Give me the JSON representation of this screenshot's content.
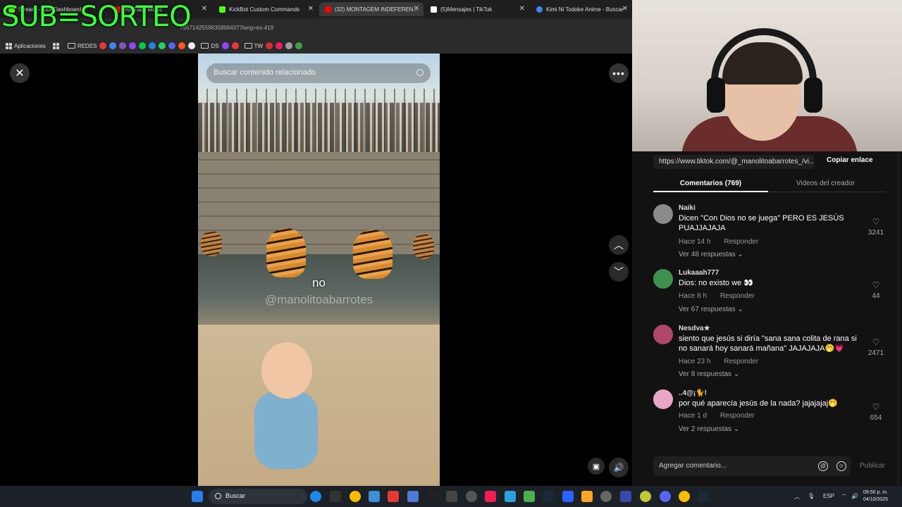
{
  "overlay": {
    "text": "SUB=SORTEO"
  },
  "browser": {
    "tabs": [
      {
        "label": "Stream - Kick Dashboard",
        "color": "#53fc18"
      },
      {
        "label": "YouTube Music",
        "color": "#ff0000"
      },
      {
        "label": "KickBot Custom Commands",
        "color": "#53fc18"
      },
      {
        "label": "(32) MONTAGEM INDEFEREN...",
        "color": "#ff0000"
      },
      {
        "label": "(5)Mensajes | TikTok",
        "color": "#ffffff"
      },
      {
        "label": "Kimi Ni Todoke Anime - Buscar",
        "color": "#4285f4"
      }
    ],
    "address": "7557142559835868437?lang=es-419",
    "bookmarks": {
      "apps": "Aplicaciones",
      "redes": "REDES",
      "ds": "DS",
      "tw": "TW"
    }
  },
  "video": {
    "search_placeholder": "Buscar contenido relacionado",
    "caption": "no",
    "watermark": "@manolitoabarrotes"
  },
  "panel": {
    "link": "https://www.tiktok.com/@_manolitoabarrotes_/vi...",
    "copy_label": "Copiar enlace",
    "tab_comments": "Comentarios (769)",
    "tab_videos": "Videos del creador",
    "reply_label": "Responder",
    "comments": [
      {
        "user": "Naiki",
        "text": "Dicen \"Con Dios no se juega\" PERO ES JESÚS PUAJJAJAJA",
        "time": "Hace 14 h",
        "more": "Ver 48 respuestas",
        "likes": "3241",
        "avatar_color": "#8a8a8a"
      },
      {
        "user": "Lukaaah777",
        "text": "Dios: no existo we 👀",
        "time": "Hace 8 h",
        "more": "Ver 67 respuestas",
        "likes": "44",
        "avatar_color": "#3f8f4f"
      },
      {
        "user": "Nesdva★",
        "text": "siento que jesús si diría \"sana sana colita de rana si no sanará hoy sanará mañana\" JAJAJAJA🤭💗",
        "time": "Hace 23 h",
        "more": "Ver 8 respuestas",
        "likes": "2471",
        "avatar_color": "#b0476a"
      },
      {
        "user": "..4@¡🐈!",
        "text": "por qué aparecía jesús de la nada? jajajajaj🤭",
        "time": "Hace 1 d",
        "more": "Ver 2 respuestas",
        "likes": "654",
        "avatar_color": "#e8a7c8"
      }
    ],
    "input_placeholder": "Agregar comentario...",
    "publish_label": "Publicar"
  },
  "taskbar": {
    "search_label": "Buscar",
    "lang": "ESP",
    "time": "09:50 p. m.",
    "date": "04/10/2025"
  }
}
